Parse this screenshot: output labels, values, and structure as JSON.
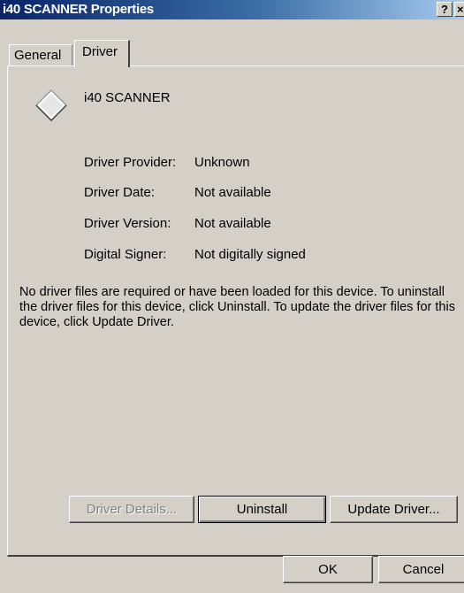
{
  "window": {
    "title": "i40 SCANNER Properties",
    "help_glyph": "?",
    "close_glyph": "×"
  },
  "tabs": [
    {
      "label": "General",
      "selected": false
    },
    {
      "label": "Driver",
      "selected": true
    }
  ],
  "device": {
    "name": "i40 SCANNER",
    "icon": "device-diamond-icon"
  },
  "properties": [
    {
      "label": "Driver Provider:",
      "value": "Unknown"
    },
    {
      "label": "Driver Date:",
      "value": "Not available"
    },
    {
      "label": "Driver Version:",
      "value": "Not available"
    },
    {
      "label": "Digital Signer:",
      "value": "Not digitally signed"
    }
  ],
  "description": "No driver files are required or have been loaded for this device. To uninstall the driver files for this device, click Uninstall. To update the driver files for this device, click Update Driver.",
  "buttons": {
    "driver_details": "Driver Details...",
    "uninstall": "Uninstall",
    "update_driver": "Update Driver...",
    "ok": "OK",
    "cancel": "Cancel"
  },
  "colors": {
    "title_gradient_start": "#0a246a",
    "title_gradient_end": "#a6caf0",
    "face": "#d4d0c8"
  }
}
